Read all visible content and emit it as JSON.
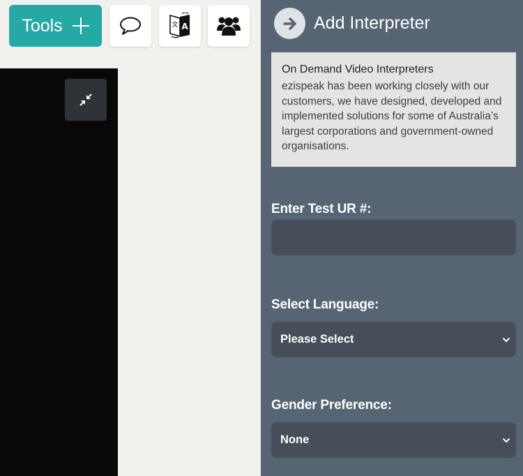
{
  "toolbar": {
    "tools_label": "Tools",
    "icons": [
      "plus-icon",
      "speech-bubble-icon",
      "translate-icon",
      "group-icon"
    ]
  },
  "video": {
    "minimize_icon": "minimize-icon"
  },
  "panel": {
    "title": "Add Interpreter",
    "header_icon": "arrow-right-icon",
    "info": {
      "title": "On Demand Video Interpreters",
      "text": "ezispeak has been working closely with our customers, we have designed, developed and implemented solutions for some of Australia’s largest corporations and government-owned organisations."
    },
    "test_ur": {
      "label": "Enter Test UR #:",
      "value": "",
      "placeholder": ""
    },
    "language": {
      "label": "Select Language:",
      "selected": "Please Select"
    },
    "gender": {
      "label": "Gender Preference:",
      "selected": "None"
    }
  },
  "colors": {
    "accent": "#26a8a4",
    "panel_bg": "#566474",
    "field_bg": "#464f59",
    "info_bg": "#e4e4e4"
  }
}
